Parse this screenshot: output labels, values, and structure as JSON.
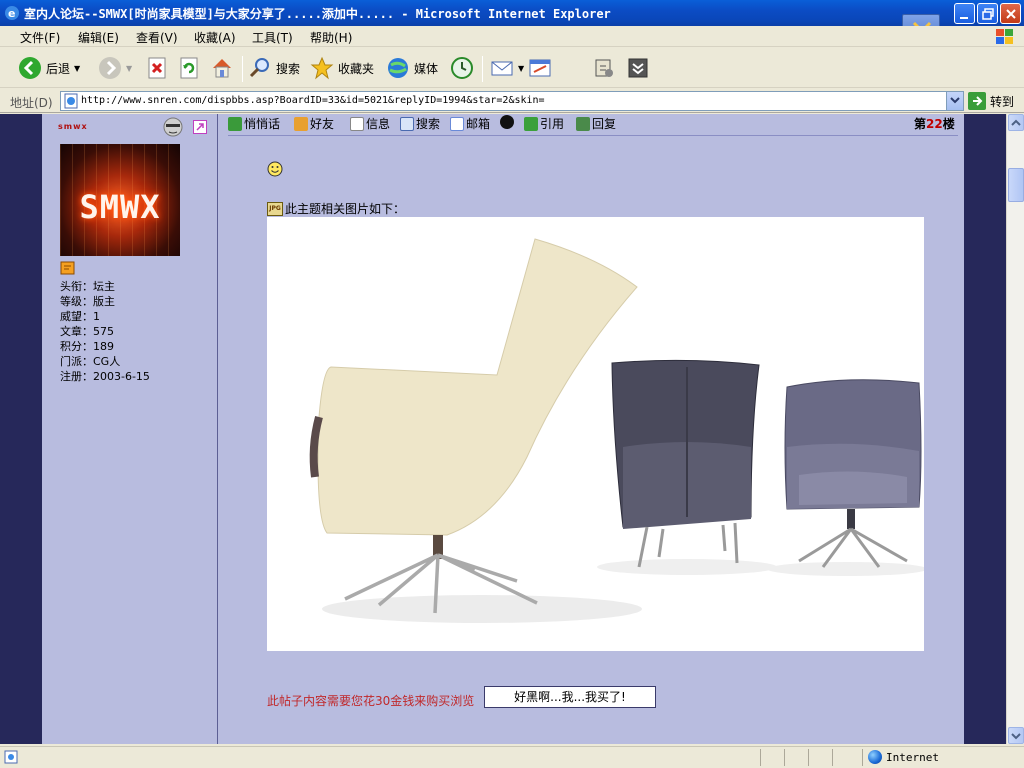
{
  "window": {
    "title": "室内人论坛--SMWX[时尚家具模型]与大家分享了.....添加中..... - Microsoft Internet Explorer"
  },
  "menu": [
    "文件(F)",
    "编辑(E)",
    "查看(V)",
    "收藏(A)",
    "工具(T)",
    "帮助(H)"
  ],
  "toolbar": {
    "back": "后退",
    "search": "搜索",
    "favorites": "收藏夹",
    "media": "媒体"
  },
  "address": {
    "label": "地址(D)",
    "url": "http://www.snren.com/dispbbs.asp?BoardID=33&id=5021&replyID=1994&star=2&skin=",
    "go": "转到"
  },
  "user": {
    "name": "smwx",
    "avatar_text": "SMWX",
    "stats": [
      "头衔：坛主",
      "等级：版主",
      "威望：1",
      "文章：575",
      "积分：189",
      "门派：CG人",
      "注册：2003-6-15"
    ]
  },
  "post": {
    "actions": [
      "悄悄话",
      "好友",
      "信息",
      "搜索",
      "邮箱",
      "",
      "引用",
      "回复"
    ],
    "floor_prefix": "第",
    "floor_number": "22",
    "floor_suffix": "楼",
    "image_caption": "此主题相关图片如下：",
    "jpg_label": "JPG",
    "buy_text": "此帖子内容需要您花30金钱来购买浏览",
    "buy_button": "好黑啊...我...我买了!"
  },
  "status": {
    "zone": "Internet"
  },
  "colors": {
    "content_bg": "#b8bcdf",
    "frame_dark": "#26285a",
    "accent_red": "#c0282a",
    "title_blue": "#0b4cc4"
  }
}
